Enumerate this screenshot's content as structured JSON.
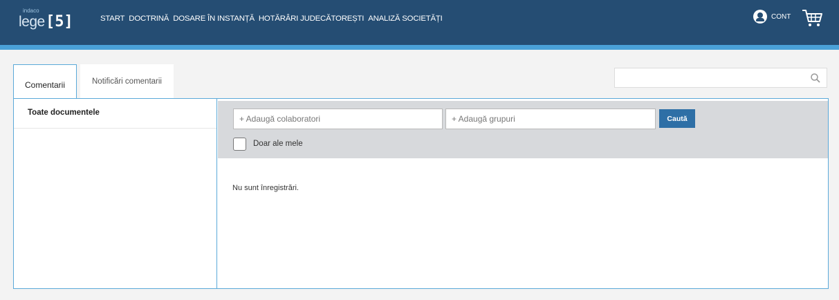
{
  "header": {
    "logo_small": "indaco",
    "logo_main": "lege",
    "logo_version": "[5]",
    "nav": [
      "START",
      "DOCTRINĂ",
      "DOSARE ÎN INSTANȚĂ",
      "HOTĂRÂRI JUDECĂTOREȘTI",
      "ANALIZĂ SOCIETĂȚI"
    ],
    "account_label": "CONT",
    "account_icon": "user-circle-icon",
    "cart_icon": "shopping-cart-icon"
  },
  "tabs": [
    {
      "label": "Comentarii",
      "active": true
    },
    {
      "label": "Notificări comentarii",
      "active": false
    }
  ],
  "search": {
    "value": "",
    "placeholder": "",
    "icon": "search-icon"
  },
  "sidebar": {
    "items": [
      {
        "label": "Toate documentele"
      }
    ]
  },
  "filters": {
    "collaborators_placeholder": "+ Adaugă colaboratori",
    "groups_placeholder": "+ Adaugă grupuri",
    "search_button": "Caută",
    "only_mine_label": "Doar ale mele",
    "only_mine_checked": false
  },
  "results": {
    "empty_message": "Nu sunt înregistrări."
  },
  "colors": {
    "header_bg": "#254d73",
    "accent": "#4aa1d8",
    "button": "#2e6fa6",
    "border": "#5aa9d9"
  }
}
